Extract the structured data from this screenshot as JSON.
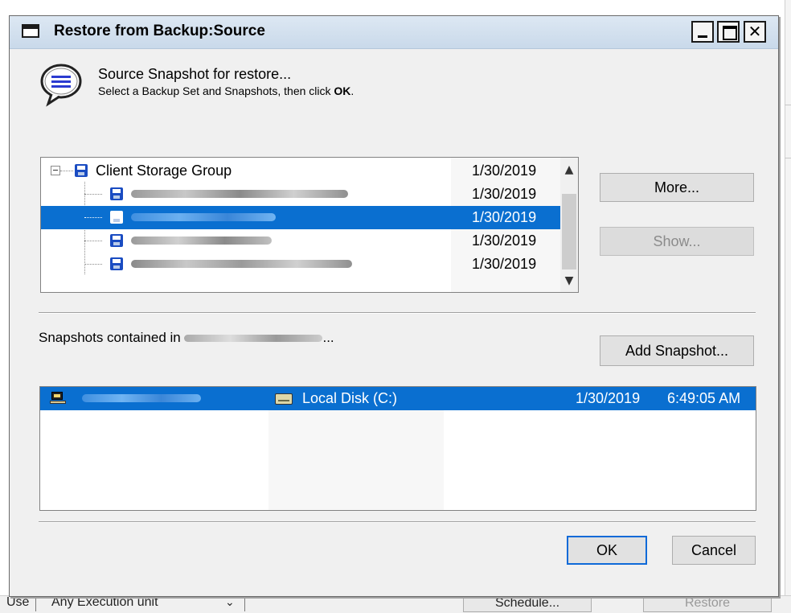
{
  "background": {
    "bottom_bar": [
      "Use",
      "Any Execution unit",
      "Schedule...",
      "Restore"
    ]
  },
  "dialog": {
    "title": "Restore from Backup:Source",
    "window_controls": {
      "minimize": "",
      "maximize": "",
      "close": "✕"
    },
    "header": {
      "title": "Source Snapshot for restore...",
      "subtitle_prefix": "Select a Backup Set and Snapshots, then click ",
      "subtitle_bold": "OK",
      "subtitle_suffix": "."
    },
    "tree": {
      "root": {
        "label": "Client Storage Group",
        "date": "1/30/2019"
      },
      "children": [
        {
          "date": "1/30/2019",
          "selected": false
        },
        {
          "date": "1/30/2019",
          "selected": true
        },
        {
          "date": "1/30/2019",
          "selected": false
        },
        {
          "date": "1/30/2019",
          "selected": false
        }
      ],
      "scroll_up": "▲",
      "scroll_down": "▼"
    },
    "buttons": {
      "more": "More...",
      "show": "Show...",
      "add_snapshot": "Add Snapshot...",
      "ok": "OK",
      "cancel": "Cancel"
    },
    "snapshots_label_prefix": "Snapshots contained in ",
    "snapshots_label_suffix": "...",
    "snapshots": [
      {
        "volume": "Local Disk (C:)",
        "date": "1/30/2019",
        "time": "6:49:05 AM",
        "selected": true
      }
    ]
  }
}
